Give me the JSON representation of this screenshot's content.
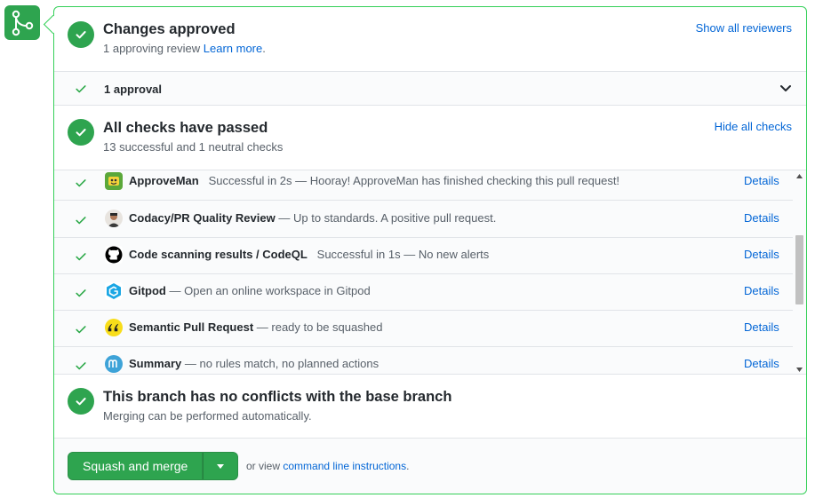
{
  "icons": {
    "merge": "git-merge-icon",
    "check": "check-icon",
    "chevron": "chevron-down-icon",
    "caret": "triangle-down-icon"
  },
  "colors": {
    "success": "#2ea44f",
    "border": "#34d058",
    "link": "#0366d6",
    "muted": "#586069"
  },
  "review": {
    "title": "Changes approved",
    "subtitle": "1 approving review",
    "learn_more": "Learn more",
    "period": ".",
    "show_all": "Show all reviewers",
    "approval_summary": "1 approval"
  },
  "checks": {
    "title": "All checks have passed",
    "subtitle": "13 successful and 1 neutral checks",
    "hide_all": "Hide all checks",
    "details_label": "Details",
    "items": [
      {
        "name": "ApproveMan",
        "description": "Successful in 2s — Hooray! ApproveMan has finished checking this pull request!",
        "icon": "approveman-icon"
      },
      {
        "name": "Codacy/PR Quality Review",
        "description": "— Up to standards. A positive pull request.",
        "icon": "codacy-avatar-icon"
      },
      {
        "name": "Code scanning results / CodeQL",
        "description": "Successful in 1s — No new alerts",
        "icon": "github-icon"
      },
      {
        "name": "Gitpod",
        "description": "— Open an online workspace in Gitpod",
        "icon": "gitpod-icon"
      },
      {
        "name": "Semantic Pull Request",
        "description": "— ready to be squashed",
        "icon": "quote-icon"
      },
      {
        "name": "Summary",
        "description": "— no rules match, no planned actions",
        "icon": "mergify-icon"
      }
    ]
  },
  "merge_status": {
    "title": "This branch has no conflicts with the base branch",
    "subtitle": "Merging can be performed automatically."
  },
  "footer": {
    "merge_button": "Squash and merge",
    "or_view": "or view",
    "cli_link": "command line instructions",
    "period": "."
  }
}
